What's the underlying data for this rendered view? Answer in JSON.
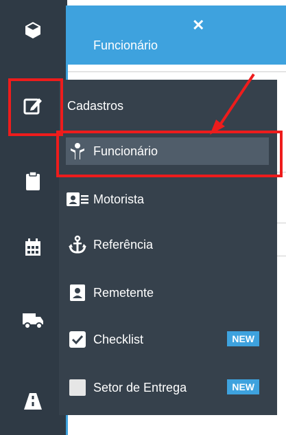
{
  "tab": {
    "title": "Funcionário",
    "close_icon": "close-icon"
  },
  "rail": {
    "items": [
      {
        "name": "cube-icon"
      },
      {
        "name": "edit-icon"
      },
      {
        "name": "clipboard-icon"
      },
      {
        "name": "calendar-icon"
      },
      {
        "name": "truck-icon"
      },
      {
        "name": "road-icon"
      }
    ]
  },
  "menu": {
    "header": "Cadastros",
    "items": [
      {
        "label": "Funcionário",
        "icon": "user-icon",
        "active": true
      },
      {
        "label": "Motorista",
        "icon": "id-card-icon"
      },
      {
        "label": "Referência",
        "icon": "anchor-icon"
      },
      {
        "label": "Remetente",
        "icon": "contact-card-icon"
      },
      {
        "label": "Checklist",
        "icon": "checkbox-icon",
        "badge": "NEW"
      },
      {
        "label": "Setor de Entrega",
        "icon": "square-icon",
        "badge": "NEW"
      }
    ]
  },
  "colors": {
    "rail": "#2f3a45",
    "menu": "#36414c",
    "accent": "#3ea2de",
    "annotation": "#ee1c1c"
  }
}
